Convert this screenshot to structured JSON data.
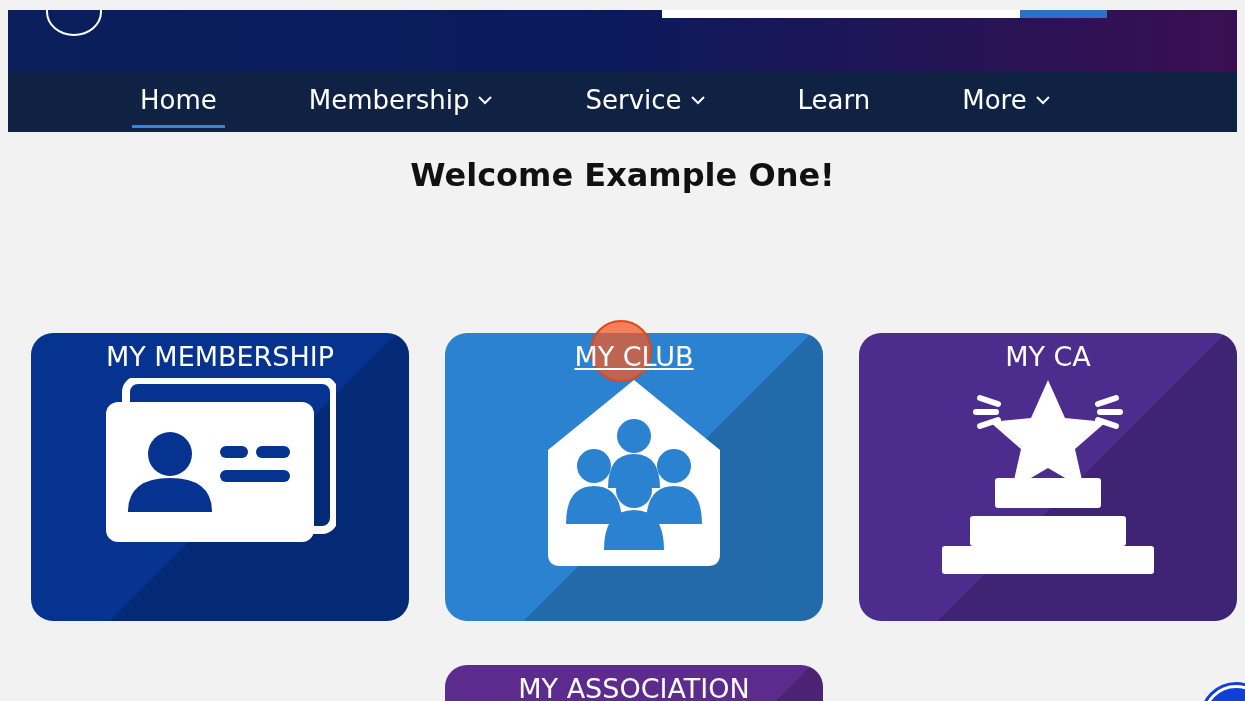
{
  "nav": {
    "items": [
      {
        "label": "Home",
        "selected": true,
        "has_dropdown": false
      },
      {
        "label": "Membership",
        "selected": false,
        "has_dropdown": true
      },
      {
        "label": "Service",
        "selected": false,
        "has_dropdown": true
      },
      {
        "label": "Learn",
        "selected": false,
        "has_dropdown": false
      },
      {
        "label": "More",
        "selected": false,
        "has_dropdown": true
      }
    ]
  },
  "welcome": "Welcome Example One!",
  "tiles": [
    {
      "title": "MY MEMBERSHIP",
      "kind": "card",
      "color": "#06338f",
      "hovered": false
    },
    {
      "title": "MY CLUB",
      "kind": "club",
      "color": "#2a82d0",
      "hovered": true
    },
    {
      "title": "MY CA",
      "kind": "star",
      "color": "#4c2c8c",
      "hovered": false
    },
    {
      "title": "MY ASSOCIATION",
      "kind": "none",
      "color": "#5d2a8e",
      "hovered": false
    }
  ]
}
